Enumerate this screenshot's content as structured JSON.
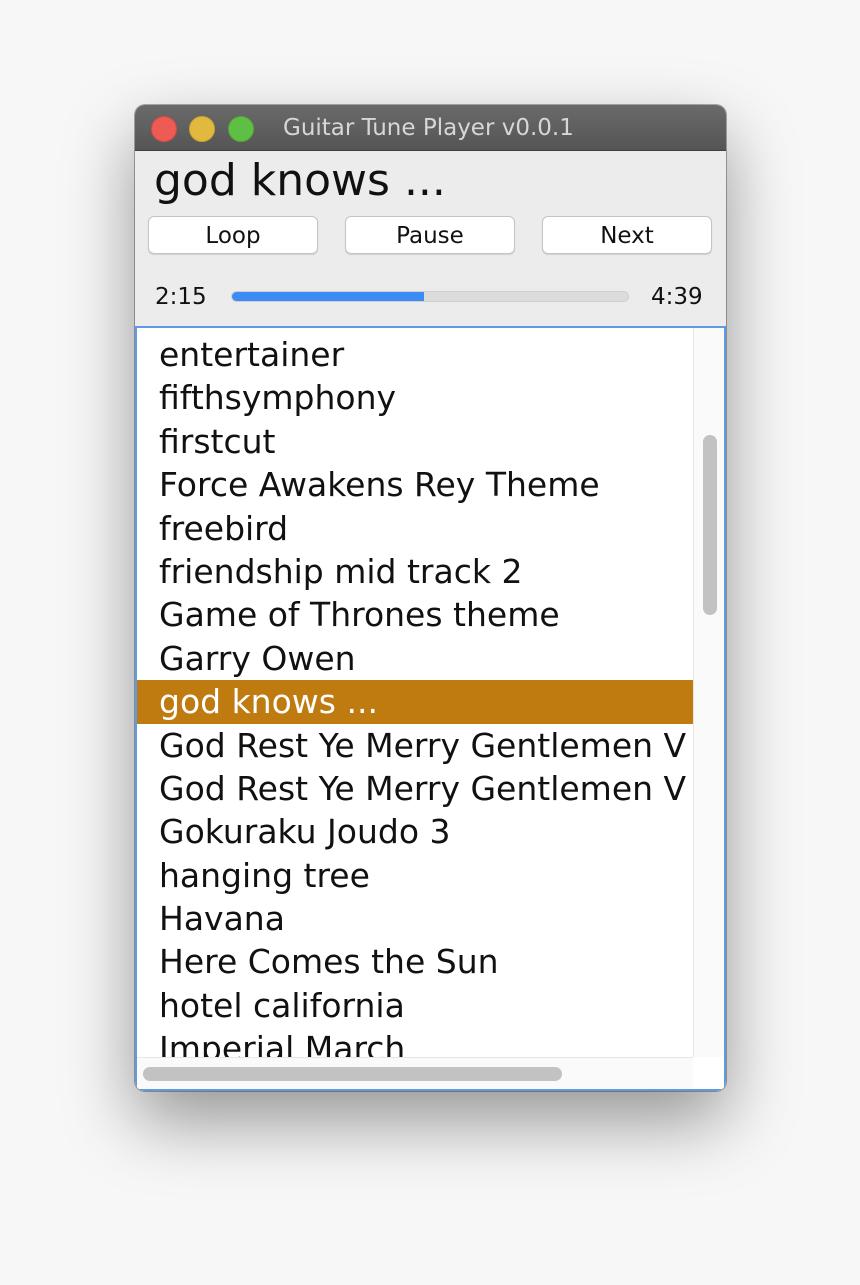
{
  "window": {
    "title": "Guitar Tune Player v0.0.1"
  },
  "player": {
    "now_playing": "god knows ...",
    "buttons": {
      "loop": "Loop",
      "pause": "Pause",
      "next": "Next"
    },
    "time_elapsed": "2:15",
    "time_total": "4:39",
    "progress_fraction": 0.484
  },
  "playlist": {
    "items": [
      "entertainer",
      "fifthsymphony",
      "firstcut",
      "Force Awakens Rey Theme",
      "freebird",
      "friendship mid track 2",
      "Game of Thrones theme",
      "Garry Owen",
      "god knows ...",
      "God Rest Ye Merry Gentlemen V",
      "God Rest Ye Merry Gentlemen V",
      "Gokuraku Joudo 3",
      "hanging tree",
      "Havana",
      "Here Comes the Sun",
      "hotel california",
      "Imperial March"
    ],
    "selected_index": 8
  },
  "scrollbars": {
    "vertical_position": 0.19,
    "vertical_visible_fraction": 0.25,
    "horizontal_position": 0.0,
    "horizontal_visible_fraction": 0.77
  },
  "colors": {
    "accent": "#3d8cf3",
    "selection": "#bf7a10",
    "focus_border": "#5b9be8"
  }
}
